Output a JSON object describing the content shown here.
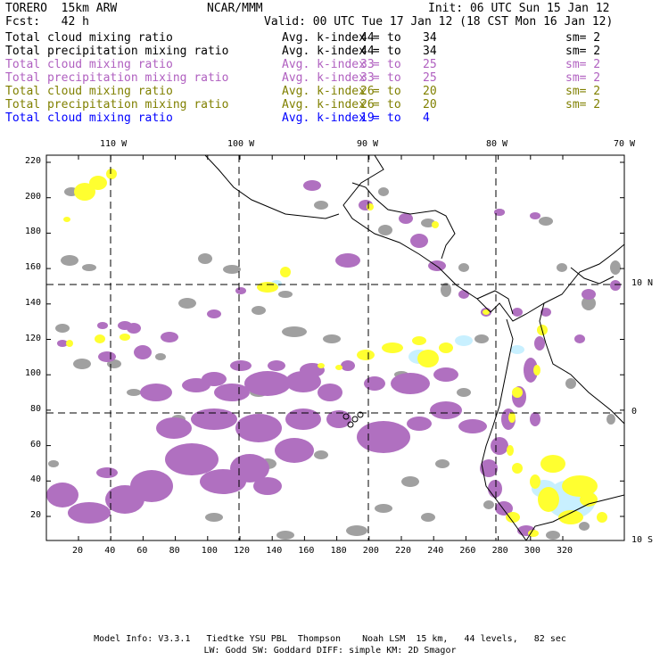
{
  "header": {
    "model": "TORERO  15km ARW",
    "org": "NCAR/MMM",
    "init": "Init: 06 UTC Sun 15 Jan 12",
    "fcst": "Fcst:   42 h",
    "valid": "Valid: 00 UTC Tue 17 Jan 12 (18 CST Mon 16 Jan 12)"
  },
  "legend": [
    {
      "field": "Total cloud mixing ratio",
      "index": "Avg. k-index = ",
      "hi": "44",
      "to": "to",
      "lo": "34",
      "sm": "sm= 2",
      "color": "#000000"
    },
    {
      "field": "Total precipitation mixing ratio",
      "index": "Avg. k-index = ",
      "hi": "44",
      "to": "to",
      "lo": "34",
      "sm": "sm= 2",
      "color": "#000000"
    },
    {
      "field": "Total cloud mixing ratio",
      "index": "Avg. k-index = ",
      "hi": "33",
      "to": "to",
      "lo": "25",
      "sm": "sm= 2",
      "color": "#b060c0"
    },
    {
      "field": "Total precipitation mixing ratio",
      "index": "Avg. k-index = ",
      "hi": "33",
      "to": "to",
      "lo": "25",
      "sm": "sm= 2",
      "color": "#b060c0"
    },
    {
      "field": "Total cloud mixing ratio",
      "index": "Avg. k-index = ",
      "hi": "26",
      "to": "to",
      "lo": "20",
      "sm": "sm= 2",
      "color": "#808000"
    },
    {
      "field": "Total precipitation mixing ratio",
      "index": "Avg. k-index = ",
      "hi": "26",
      "to": "to",
      "lo": "20",
      "sm": "sm= 2",
      "color": "#808000"
    },
    {
      "field": "Total cloud mixing ratio",
      "index": "Avg. k-index = ",
      "hi": "19",
      "to": "to",
      "lo": "4",
      "sm": "",
      "color": "#0000ff"
    }
  ],
  "map": {
    "lon_labels": [
      "110 W",
      "100 W",
      "90 W",
      "80 W",
      "70 W"
    ],
    "lat_labels": [
      "10 N",
      "0",
      "10 S"
    ],
    "x_ticks": [
      "20",
      "40",
      "60",
      "80",
      "100",
      "120",
      "140",
      "160",
      "180",
      "200",
      "220",
      "240",
      "260",
      "280",
      "300",
      "320"
    ],
    "y_ticks": [
      "220",
      "200",
      "180",
      "160",
      "140",
      "120",
      "100",
      "80",
      "60",
      "40",
      "20"
    ],
    "colors": {
      "gray": "#a0a0a0",
      "purple": "#b070c0",
      "yellow": "#ffff30",
      "lightblue": "#c8f0ff",
      "coast": "#000000",
      "grid": "#000000"
    }
  },
  "footer": {
    "line1": "Model Info: V3.3.1   Tiedtke YSU PBL  Thompson    Noah LSM  15 km,   44 levels,   82 sec",
    "line2": "LW: Godd SW: Goddard DIFF: simple KM: 2D Smagor"
  }
}
